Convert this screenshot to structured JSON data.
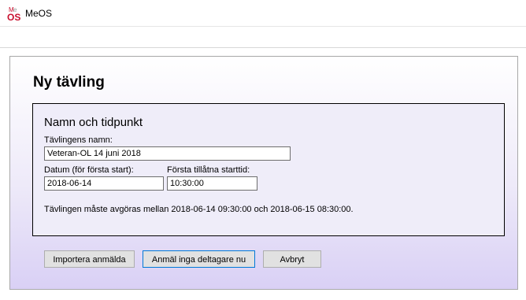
{
  "window": {
    "title": "MeOS",
    "icon": "meos-logo-icon"
  },
  "dialog": {
    "heading": "Ny tävling",
    "group_title": "Namn och tidpunkt",
    "name_label": "Tävlingens namn:",
    "name_value": "Veteran-OL 14 juni 2018",
    "date_label": "Datum (för första start):",
    "date_value": "2018-06-14",
    "time_label": "Första tillåtna starttid:",
    "time_value": "10:30:00",
    "info_text": "Tävlingen måste avgöras mellan 2018-06-14 09:30:00 och 2018-06-15 08:30:00."
  },
  "buttons": {
    "import": "Importera anmälda",
    "no_entries": "Anmäl inga deltagare nu",
    "cancel": "Avbryt"
  },
  "colors": {
    "accent": "#0078d7",
    "logo_red": "#c8102e",
    "gradient_bottom": "#d9d0f5"
  }
}
